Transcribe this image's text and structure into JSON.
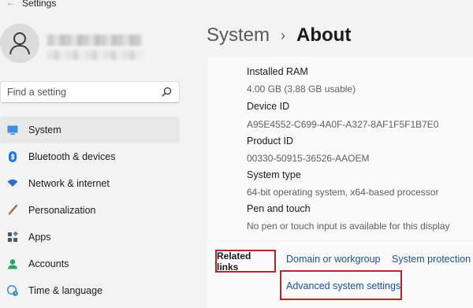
{
  "window": {
    "title": "Settings"
  },
  "user": {},
  "search": {
    "placeholder": "Find a setting"
  },
  "sidebar": {
    "items": [
      {
        "label": "System",
        "icon": "system-icon",
        "color": "#2f7bd6",
        "active": true
      },
      {
        "label": "Bluetooth & devices",
        "icon": "bluetooth-icon",
        "color": "#1e78d4"
      },
      {
        "label": "Network & internet",
        "icon": "wifi-icon",
        "color": "#2b6fcf"
      },
      {
        "label": "Personalization",
        "icon": "brush-icon",
        "color": "#c77b3b"
      },
      {
        "label": "Apps",
        "icon": "apps-icon",
        "color": "#4a5a6a"
      },
      {
        "label": "Accounts",
        "icon": "accounts-icon",
        "color": "#2fa36a"
      },
      {
        "label": "Time & language",
        "icon": "globe-clock-icon",
        "color": "#2b8ad1"
      }
    ]
  },
  "header": {
    "parent": "System",
    "separator": "›",
    "current": "About"
  },
  "specs": [
    {
      "label": "Installed RAM",
      "value": "4.00 GB (3.88 GB usable)"
    },
    {
      "label": "Device ID",
      "value": "A95E4552-C699-4A0F-A327-8AF1F5F1B7E0"
    },
    {
      "label": "Product ID",
      "value": "00330-50915-36526-AAOEM"
    },
    {
      "label": "System type",
      "value": "64-bit operating system, x64-based processor"
    },
    {
      "label": "Pen and touch",
      "value": "No pen or touch input is available for this display"
    }
  ],
  "related": {
    "label": "Related links",
    "links": [
      "Domain or workgroup",
      "System protection",
      "Advanced system settings"
    ]
  },
  "colors": {
    "accent": "#1b4f93",
    "highlight_border": "#b3262e"
  }
}
